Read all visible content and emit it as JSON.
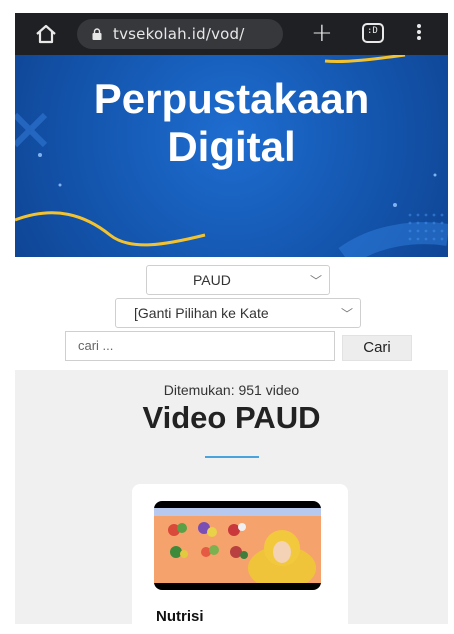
{
  "browser": {
    "url": "tvsekolah.id/vod/",
    "tab_count": ":D"
  },
  "banner": {
    "title_line1": "Perpustakaan",
    "title_line2": "Digital"
  },
  "filters": {
    "level": "PAUD",
    "category": "[Ganti Pilihan ke Kate",
    "search_placeholder": "cari ...",
    "search_button": "Cari"
  },
  "results": {
    "found_text": "Ditemukan: 951 video",
    "heading": "Video PAUD",
    "items": [
      {
        "title": "Nutrisi"
      }
    ]
  },
  "colors": {
    "chrome_bg": "#1f2023",
    "banner_blue": "#1457b0",
    "accent_underline": "#49a3dc"
  }
}
